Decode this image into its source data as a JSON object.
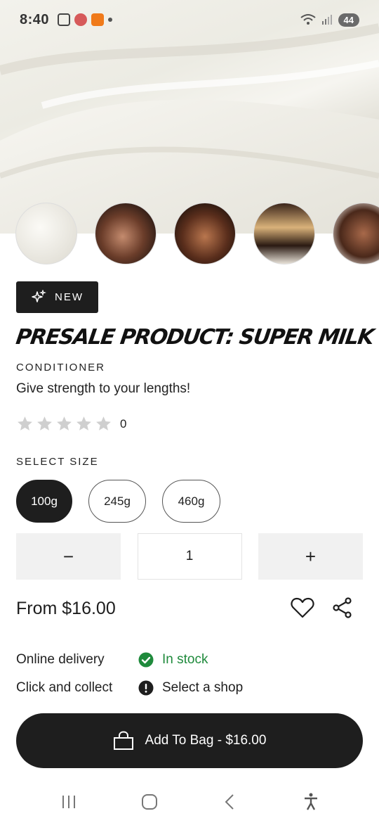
{
  "status_bar": {
    "time": "8:40",
    "battery": "44"
  },
  "badge": {
    "label": "NEW",
    "icon": "sparkle-icon"
  },
  "product": {
    "title": "PRESALE PRODUCT: SUPER MILK",
    "category": "CONDITIONER",
    "tagline": "Give strength to your lengths!",
    "rating": 0,
    "rating_count": "0"
  },
  "size": {
    "label": "SELECT SIZE",
    "options": [
      "100g",
      "245g",
      "460g"
    ],
    "selected": "100g"
  },
  "quantity": {
    "minus": "−",
    "value": "1",
    "plus": "+"
  },
  "price": {
    "text": "From $16.00"
  },
  "delivery": {
    "online_label": "Online delivery",
    "online_status": "In stock",
    "collect_label": "Click and collect",
    "collect_status": "Select a shop"
  },
  "cta": {
    "label": "Add To Bag - $16.00"
  },
  "colors": {
    "accent": "#1e1e1e",
    "in_stock": "#1f8a3c",
    "qty_bg": "#f1f1f1"
  }
}
